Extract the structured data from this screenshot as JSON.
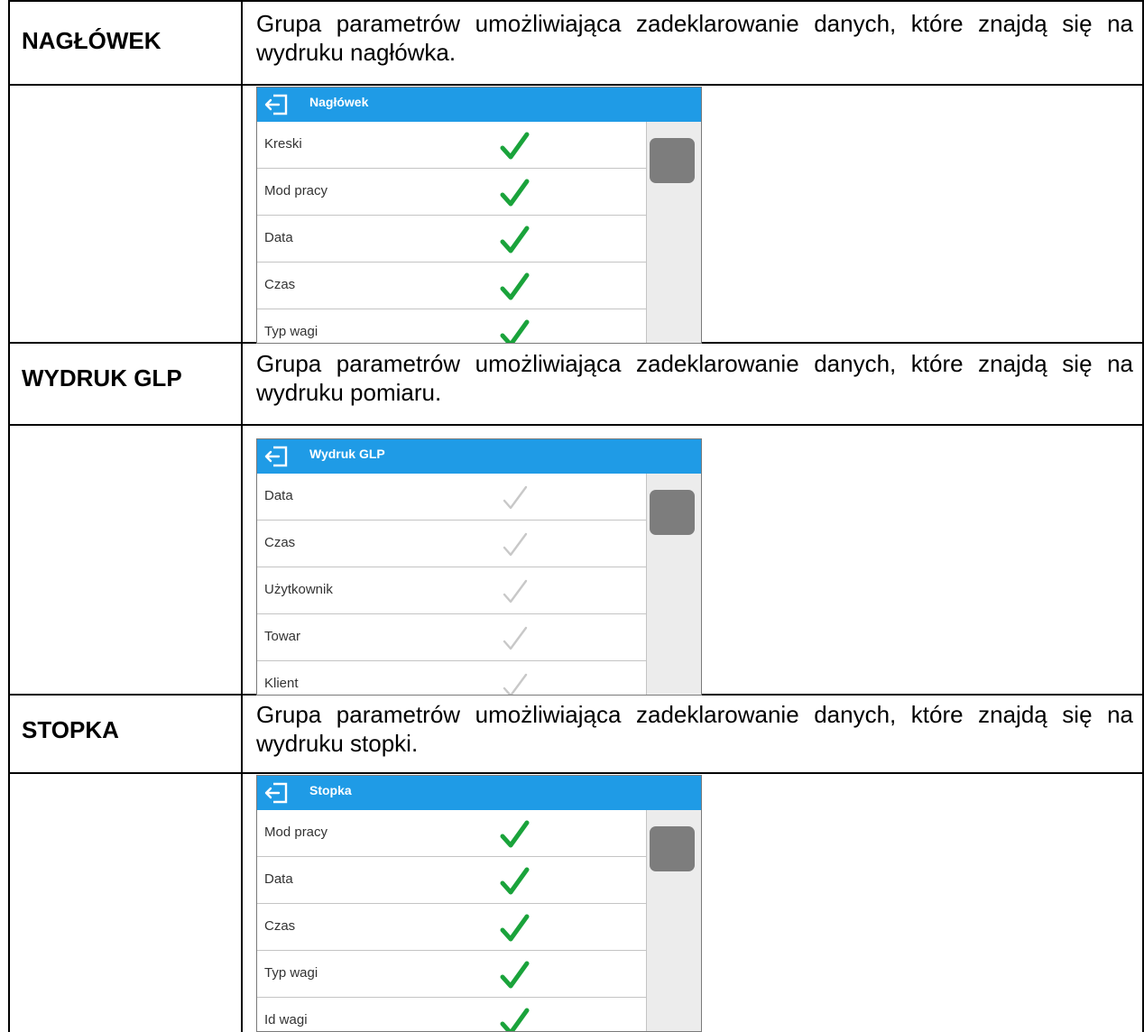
{
  "rows": [
    {
      "label": "NAGŁÓWEK",
      "description": "Grupa parametrów umożliwiająca zadeklarowanie danych, które znajdą się na wydruku nagłówka.",
      "screen": {
        "title": "Nagłówek",
        "check_color": "#1aa33b",
        "check_state": "enabled",
        "items": [
          "Kreski",
          "Mod pracy",
          "Data",
          "Czas",
          "Typ wagi"
        ]
      }
    },
    {
      "label": "WYDRUK GLP",
      "description": "Grupa parametrów umożliwiająca zadeklarowanie danych, które znajdą się na wydruku pomiaru.",
      "screen": {
        "title": "Wydruk GLP",
        "check_color": "#c8c8c8",
        "check_state": "disabled",
        "items": [
          "Data",
          "Czas",
          "Użytkownik",
          "Towar",
          "Klient"
        ]
      }
    },
    {
      "label": "STOPKA",
      "description": "Grupa parametrów umożliwiająca zadeklarowanie danych, które znajdą się na wydruku stopki.",
      "screen": {
        "title": "Stopka",
        "check_color": "#1aa33b",
        "check_state": "enabled",
        "items": [
          "Mod pracy",
          "Data",
          "Czas",
          "Typ wagi",
          "Id wagi"
        ]
      }
    }
  ],
  "colors": {
    "titlebar": "#1f9be6",
    "scroll_thumb": "#7d7d7d",
    "scroll_track": "#ececec"
  },
  "icons": {
    "back": "back-arrow-icon",
    "check": "check-icon"
  }
}
